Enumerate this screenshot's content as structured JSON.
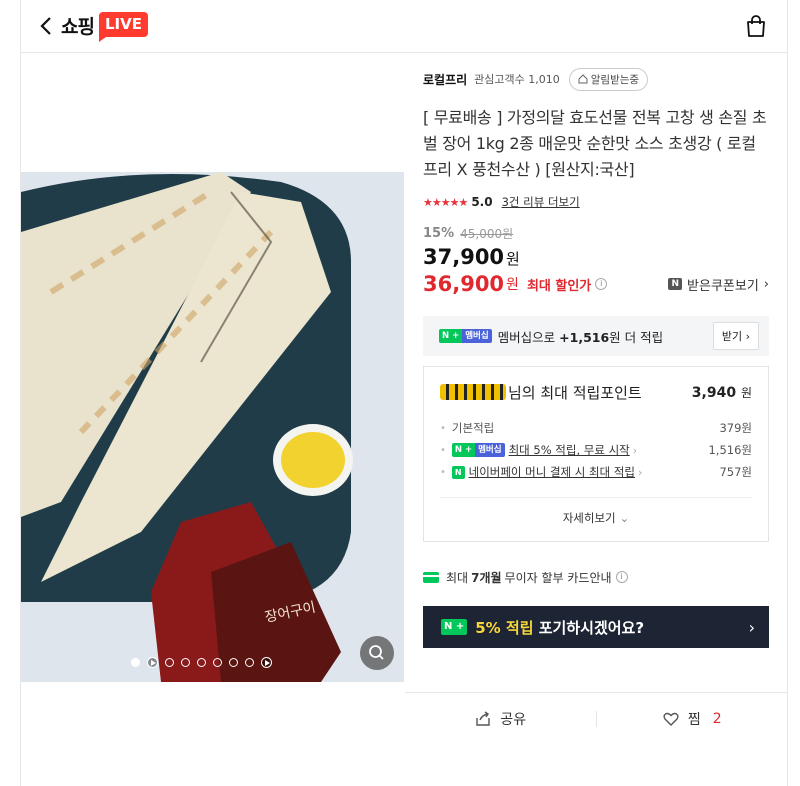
{
  "header": {
    "brand": "쇼핑",
    "live": "LIVE",
    "icons": [
      "back-arrow-icon",
      "shopping-bag-icon"
    ]
  },
  "product": {
    "store_name": "로컬프리",
    "fans_label": "관심고객수 1,010",
    "notify_label": "알림받는중",
    "title": "[ 무료배송 ] 가정의달 효도선물 전복 고창 생 손질 초벌 장어 1kg 2종 매운맛 순한맛 소스 초생강 ( 로컬프리 X 풍천수산 ) [원산지:국산]",
    "stars": "★★★★★",
    "score": "5.0",
    "review_link": "3건 리뷰 더보기",
    "discount_rate": "15%",
    "original_price": "45,000원",
    "price": "37,900",
    "price_unit": "원",
    "max_discount_price": "36,900",
    "max_discount_unit": "원",
    "max_discount_label": "최대 할인가",
    "coupon_badge": "N",
    "coupon_label": "받은쿠폰보기",
    "rating": 5.0
  },
  "membership": {
    "text_prefix": "멤버십으로 ",
    "amount": "+1,516",
    "text_suffix": "원 더 적립",
    "receive_btn": "받기",
    "badge_n": "N +",
    "badge_m": "멤버십"
  },
  "points": {
    "title_suffix": "님의 최대 적립포인트",
    "total": "3,940",
    "total_unit": "원",
    "rows": [
      {
        "label": "기본적립",
        "value": "379원"
      },
      {
        "label": "최대 5% 적립, 무료 시작",
        "value": "1,516원"
      },
      {
        "label": "네이버페이 머니 결제 시 최대 적립",
        "value": "757원"
      }
    ],
    "detail_btn": "자세히보기"
  },
  "card": {
    "prefix": "최대",
    "months": "7개월",
    "suffix": "무이자 할부 카드안내"
  },
  "banner": {
    "highlight": "5% 적립",
    "text": " 포기하시겠어요?"
  },
  "actions": {
    "share": "공유",
    "like": "찜",
    "like_count": "2"
  },
  "gallery": {
    "dot_count": 9,
    "active_index": 0
  },
  "colors": {
    "accent_red": "#e0282f",
    "naver_green": "#03c75a",
    "live_red": "#ff3b2f",
    "banner_bg": "#1d2434"
  }
}
